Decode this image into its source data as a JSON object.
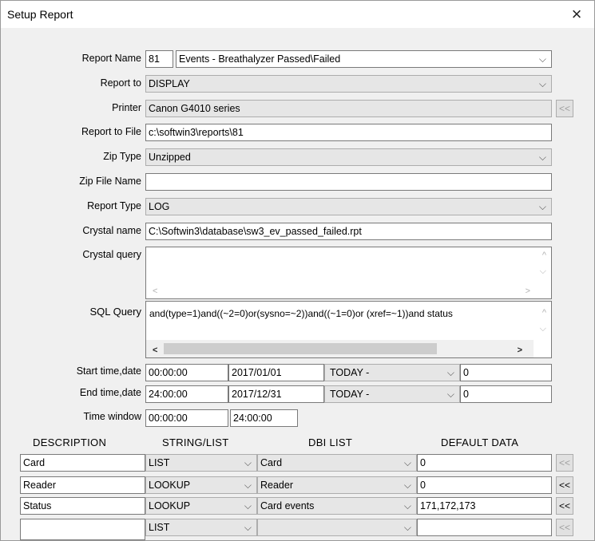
{
  "window": {
    "title": "Setup Report",
    "close_glyph": "×"
  },
  "labels": {
    "report_name": "Report Name",
    "report_to": "Report to",
    "printer": "Printer",
    "report_to_file": "Report to File",
    "zip_type": "Zip Type",
    "zip_file_name": "Zip File Name",
    "report_type": "Report Type",
    "crystal_name": "Crystal name",
    "crystal_query": "Crystal query",
    "sql_query": "SQL Query",
    "start_time_date": "Start time,date",
    "end_time_date": "End time,date",
    "time_window": "Time window"
  },
  "fields": {
    "report_number": "81",
    "report_name": "Events - Breathalyzer Passed\\Failed",
    "report_to": "DISPLAY",
    "printer": "Canon G4010 series",
    "report_to_file": "c:\\softwin3\\reports\\81",
    "zip_type": "Unzipped",
    "zip_file_name": "",
    "report_type": "LOG",
    "crystal_name": "C:\\Softwin3\\database\\sw3_ev_passed_failed.rpt",
    "crystal_query": "",
    "sql_query": "and(type=1)and((~2=0)or(sysno=~2))and((~1=0)or (xref=~1))and status",
    "start_time": "00:00:00",
    "start_date": "2017/01/01",
    "start_relative": "TODAY -",
    "start_offset": "0",
    "end_time": "24:00:00",
    "end_date": "2017/12/31",
    "end_relative": "TODAY -",
    "end_offset": "0",
    "window_start": "00:00:00",
    "window_end": "24:00:00"
  },
  "glyphs": {
    "dropdown": "⌵",
    "back": "<<",
    "left": "<",
    "right": ">",
    "up": "^",
    "down": "⌵"
  },
  "columns": {
    "description": "DESCRIPTION",
    "string_list": "STRING/LIST",
    "dbi_list": "DBI LIST",
    "default_data": "DEFAULT DATA"
  },
  "rows": [
    {
      "description": "Card",
      "string_list": "LIST",
      "dbi": "Card",
      "default": "0"
    },
    {
      "description": "Reader",
      "string_list": "LOOKUP",
      "dbi": "Reader",
      "default": "0"
    },
    {
      "description": "Status",
      "string_list": "LOOKUP",
      "dbi": "Card events",
      "default": "171,172,173"
    },
    {
      "description": "",
      "string_list": "LIST",
      "dbi": "",
      "default": ""
    }
  ]
}
